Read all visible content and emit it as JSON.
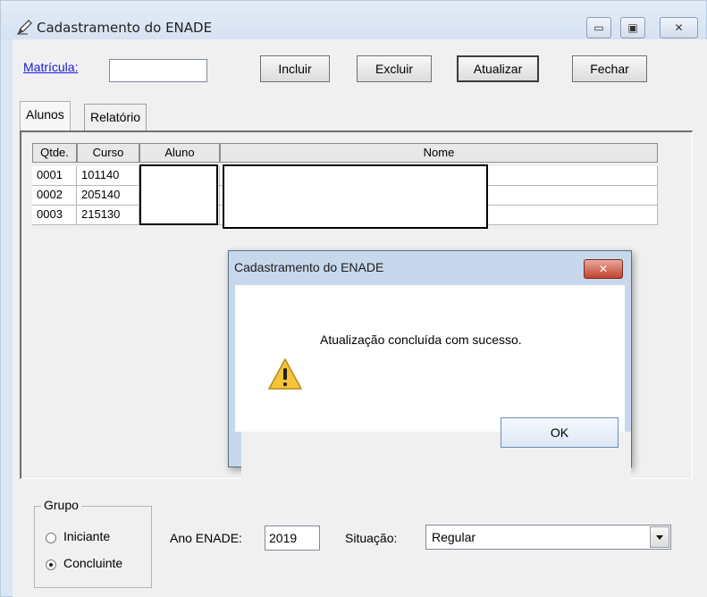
{
  "window": {
    "title": "Cadastramento do ENADE",
    "title_icon": "pencil-icon",
    "controls": [
      "minimize-icon",
      "maximize-icon",
      "close-icon"
    ]
  },
  "toolbar": {
    "matricula_label": "Matrícula:",
    "matricula_value": "",
    "incluir_label": "Incluir",
    "excluir_label": "Excluir",
    "atualizar_label": "Atualizar",
    "fechar_label": "Fechar"
  },
  "tabs": [
    {
      "label": "Alunos",
      "active": true
    },
    {
      "label": "Relatório",
      "active": false
    }
  ],
  "grid": {
    "columns": [
      "Qtde.",
      "Curso",
      "Aluno",
      "Nome"
    ],
    "rows": [
      {
        "qtde": "0001",
        "curso": "101140",
        "aluno": "",
        "nome": ""
      },
      {
        "qtde": "0002",
        "curso": "205140",
        "aluno": "",
        "nome": ""
      },
      {
        "qtde": "0003",
        "curso": "215130",
        "aluno": "",
        "nome": ""
      }
    ]
  },
  "dialog": {
    "title": "Cadastramento do ENADE",
    "icon": "warning-icon",
    "message": "Atualização concluída com sucesso.",
    "ok_label": "OK"
  },
  "grupo": {
    "label": "Grupo",
    "options": [
      {
        "label": "Iniciante",
        "selected": false
      },
      {
        "label": "Concluinte",
        "selected": true
      }
    ]
  },
  "ano_enade": {
    "label": "Ano ENADE:",
    "value": "2019"
  },
  "situacao": {
    "label": "Situação:",
    "value": "Regular"
  },
  "colors": {
    "accent": "#1a1adb",
    "dialog_close": "#c2432e"
  }
}
